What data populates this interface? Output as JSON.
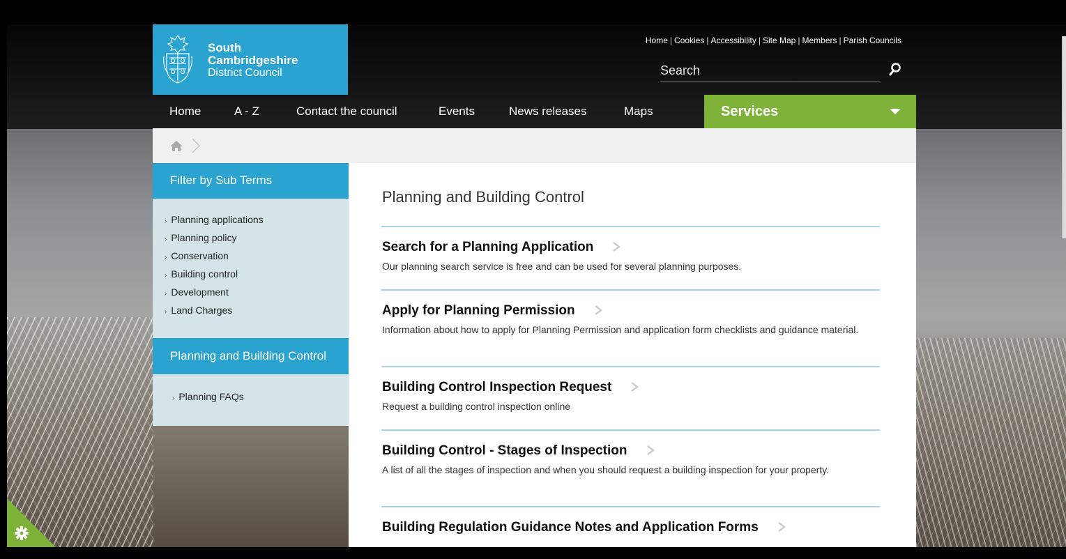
{
  "logo": {
    "line1": "South",
    "line2": "Cambridgeshire",
    "line3": "District Council"
  },
  "utility": {
    "links": [
      "Home",
      "Cookies",
      "Accessibility",
      "Site Map",
      "Members",
      "Parish Councils"
    ],
    "separator": "|"
  },
  "search": {
    "placeholder": "Search"
  },
  "nav": {
    "items": [
      "Home",
      "A - Z",
      "Contact the council",
      "Events",
      "News releases",
      "Maps"
    ],
    "services_label": "Services"
  },
  "sidebar": {
    "filter_heading": "Filter by Sub Terms",
    "filter_items": [
      "Planning applications",
      "Planning policy",
      "Conservation",
      "Building control",
      "Development",
      "Land Charges"
    ],
    "section_heading": "Planning and Building Control",
    "section_items": [
      "Planning FAQs"
    ],
    "arrow": "›"
  },
  "main": {
    "title": "Planning and Building Control",
    "entries": [
      {
        "title": "Search for a Planning Application",
        "desc": "Our planning search service is free and can be used for several planning purposes."
      },
      {
        "title": "Apply for Planning Permission",
        "desc": "Information about how to apply for Planning Permission and application form checklists and guidance material."
      },
      {
        "title": "Building Control Inspection Request",
        "desc": "Request a building control inspection online"
      },
      {
        "title": "Building Control - Stages of Inspection",
        "desc": "A list of all the stages of inspection and when you should request a building inspection for your property."
      },
      {
        "title": "Building Regulation Guidance Notes and Application Forms",
        "desc": ""
      }
    ]
  },
  "colors": {
    "brand_blue": "#2aa3d0",
    "services_green": "#7fb239",
    "sidebar_bg": "#d4e4e8",
    "divider": "#aad3e6"
  }
}
